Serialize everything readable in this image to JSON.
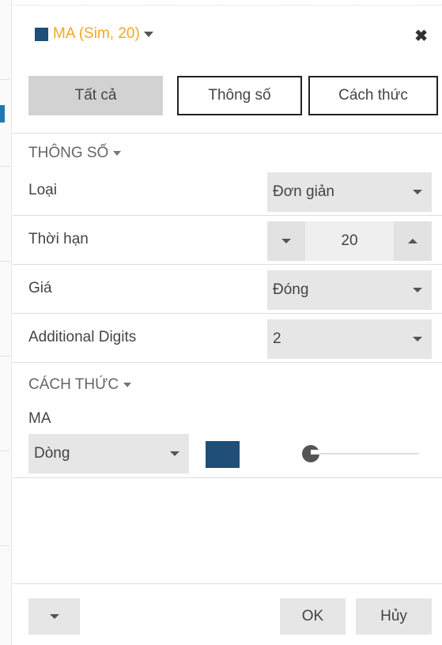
{
  "dialog": {
    "title": "MA (Sim, 20)",
    "title_color": "#f5a623",
    "series_color": "#1f4e79",
    "close_icon": "close-icon"
  },
  "tabs": [
    {
      "label": "Tất cả",
      "active": true
    },
    {
      "label": "Thông số",
      "active": false
    },
    {
      "label": "Cách thức",
      "active": false
    }
  ],
  "params": {
    "section_title": "THÔNG SỐ",
    "type_label": "Loại",
    "type_value": "Đơn giản",
    "period_label": "Thời hạn",
    "period_value": "20",
    "price_label": "Giá",
    "price_value": "Đóng",
    "digits_label": "Additional Digits",
    "digits_value": "2"
  },
  "style": {
    "section_title": "CÁCH THỨC",
    "line_name": "MA",
    "line_type": "Dòng",
    "line_color": "#1f4e79",
    "line_opacity": 0
  },
  "footer": {
    "ok_label": "OK",
    "cancel_label": "Hủy"
  }
}
